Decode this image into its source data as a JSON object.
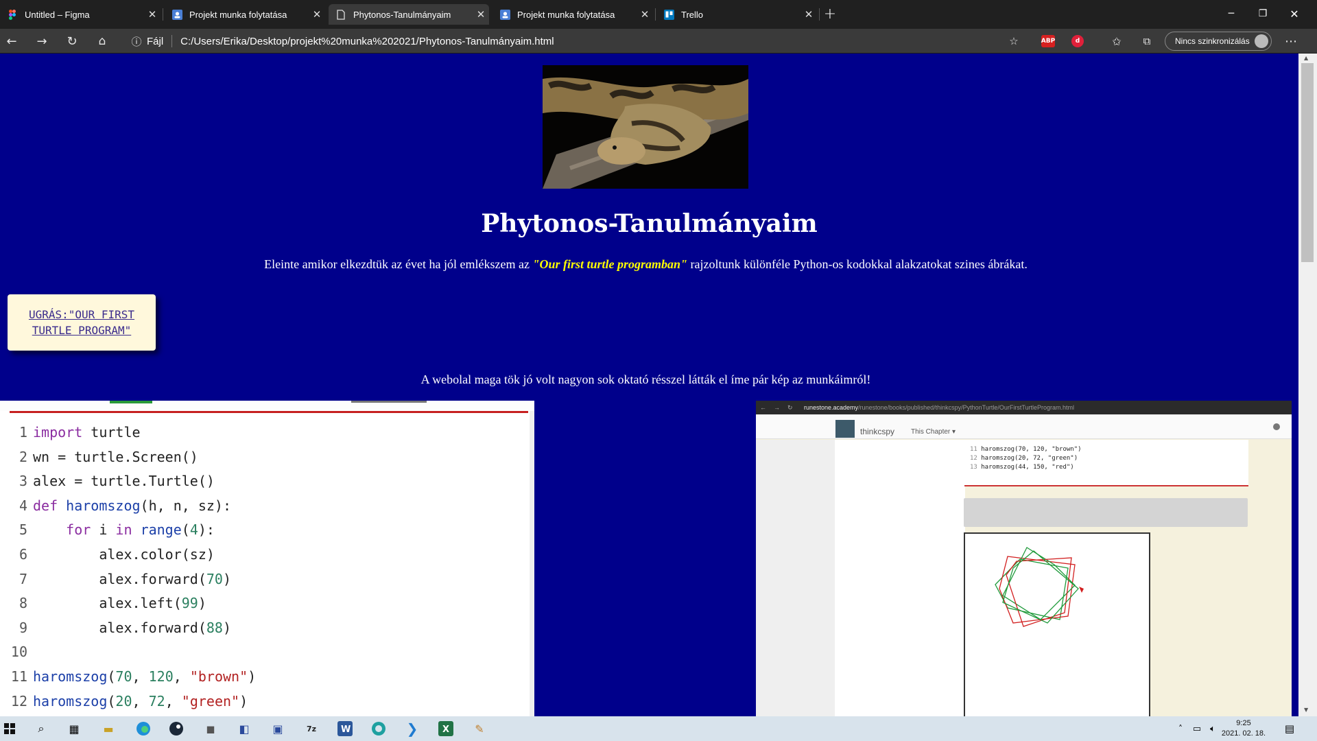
{
  "tabs": [
    {
      "label": "Untitled – Figma",
      "icon": "figma-icon"
    },
    {
      "label": "Projekt munka folytatása",
      "icon": "doc-user-icon"
    },
    {
      "label": "Phytonos-Tanulmányaim",
      "icon": "page-icon",
      "active": true
    },
    {
      "label": "Projekt munka folytatása",
      "icon": "doc-user-icon"
    },
    {
      "label": "Trello",
      "icon": "trello-icon"
    }
  ],
  "address": {
    "security_label": "Fájl",
    "url": "C:/Users/Erika/Desktop/projekt%20munka%202021/Phytonos-Tanulmányaim.html"
  },
  "extensions": {
    "abp": "ABP"
  },
  "sync_label": "Nincs szinkronizálás",
  "page": {
    "title": "Phytonos-Tanulmányaim",
    "intro_before": "Eleinte amikor elkezdtük az évet ha jól emlékszem az ",
    "intro_em": "\"Our first turtle programban\"",
    "intro_after": " rajzoltunk különféle Python-os kodokkal alakzatokat szines ábrákat.",
    "jump_link": "UGRÁS:\"OUR FIRST TURTLE PROGRAM\"",
    "web_text": "A webolal maga tök jó volt nagyon sok oktató résszel látták el íme pár kép az munkáimról!"
  },
  "code_lines": [
    {
      "n": "1",
      "t": "import turtle"
    },
    {
      "n": "2",
      "t": "wn = turtle.Screen()"
    },
    {
      "n": "3",
      "t": "alex = turtle.Turtle()"
    },
    {
      "n": "4",
      "t": "def haromszog(h, n, sz):"
    },
    {
      "n": "5",
      "t": "    for i in range(4):"
    },
    {
      "n": "6",
      "t": "        alex.color(sz)"
    },
    {
      "n": "7",
      "t": "        alex.forward(70)"
    },
    {
      "n": "8",
      "t": "        alex.left(99)"
    },
    {
      "n": "9",
      "t": "        alex.forward(88)"
    },
    {
      "n": "10",
      "t": ""
    },
    {
      "n": "11",
      "t": "haromszog(70, 120, \"brown\")"
    },
    {
      "n": "12",
      "t": "haromszog(20, 72, \"green\")"
    }
  ],
  "runestone": {
    "url_host": "runestone.academy",
    "url_path": "/runestone/books/published/thinkcspy/PythonTurtle/OurFirstTurtleProgram.html",
    "brand": "thinkcspy",
    "chapter_menu": "This Chapter",
    "lines": [
      {
        "n": "11",
        "t": "haromszog(70, 120, \"brown\")"
      },
      {
        "n": "12",
        "t": "haromszog(20, 72, \"green\")"
      },
      {
        "n": "13",
        "t": "haromszog(44, 150, \"red\")"
      }
    ]
  },
  "clock": {
    "time": "9:25",
    "date": "2021. 02. 18."
  },
  "colors": {
    "page_bg": "#00008b",
    "highlight": "#ffff00",
    "jump_bg": "#fff8dc"
  }
}
